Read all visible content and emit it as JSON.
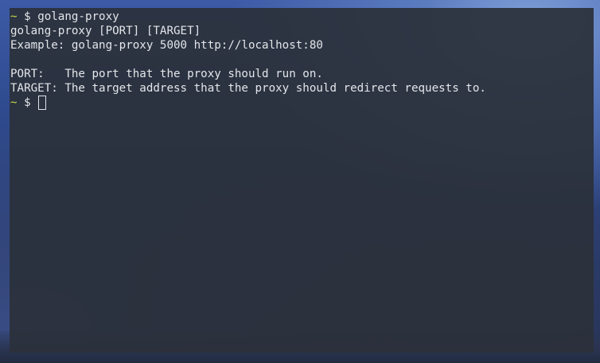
{
  "terminal": {
    "prompt": {
      "tilde": "~",
      "symbol": "$"
    },
    "command": "golang-proxy",
    "output": [
      "golang-proxy [PORT] [TARGET]",
      "Example: golang-proxy 5000 http://localhost:80",
      "",
      "PORT:   The port that the proxy should run on.",
      "TARGET: The target address that the proxy should redirect requests to."
    ]
  },
  "colors": {
    "prompt_tilde": "#c7da49",
    "text": "#e3e6ea",
    "terminal_bg": "#2b303a"
  }
}
